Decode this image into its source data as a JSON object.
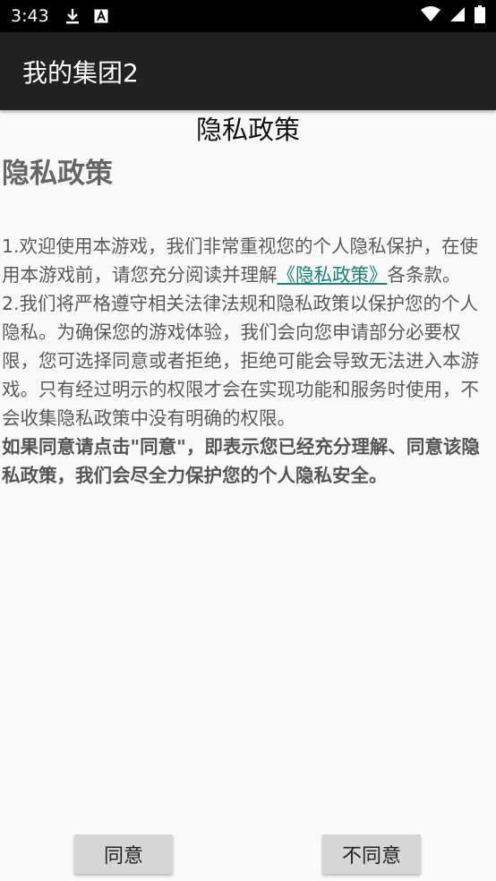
{
  "status_bar": {
    "time": "3:43",
    "icons": [
      "download-icon",
      "a-badge-icon",
      "wifi-icon",
      "signal-icon",
      "battery-icon"
    ]
  },
  "app_bar": {
    "title": "我的集团2"
  },
  "dialog": {
    "center_title": "隐私政策",
    "heading": "隐私政策",
    "para1_before": "1.欢迎使用本游戏，我们非常重视您的个人隐私保护，在使用本游戏前，请您充分阅读并理解",
    "para1_link": "《隐私政策》",
    "para1_after": "各条款。",
    "para2": "2.我们将严格遵守相关法律法规和隐私政策以保护您的个人隐私。为确保您的游戏体验，我们会向您申请部分必要权限，您可选择同意或者拒绝，拒绝可能会导致无法进入本游戏。只有经过明示的权限才会在实现功能和服务时使用，不会收集隐私政策中没有明确的权限。",
    "bold_note": "如果同意请点击\"同意\"，即表示您已经充分理解、同意该隐私政策，我们会尽全力保护您的个人隐私安全。"
  },
  "buttons": {
    "agree": "同意",
    "disagree": "不同意"
  },
  "colors": {
    "status_bar_bg": "#000000",
    "app_bar_bg": "#212121",
    "link": "#1b7f7a",
    "button_bg": "#d6d6d6"
  }
}
